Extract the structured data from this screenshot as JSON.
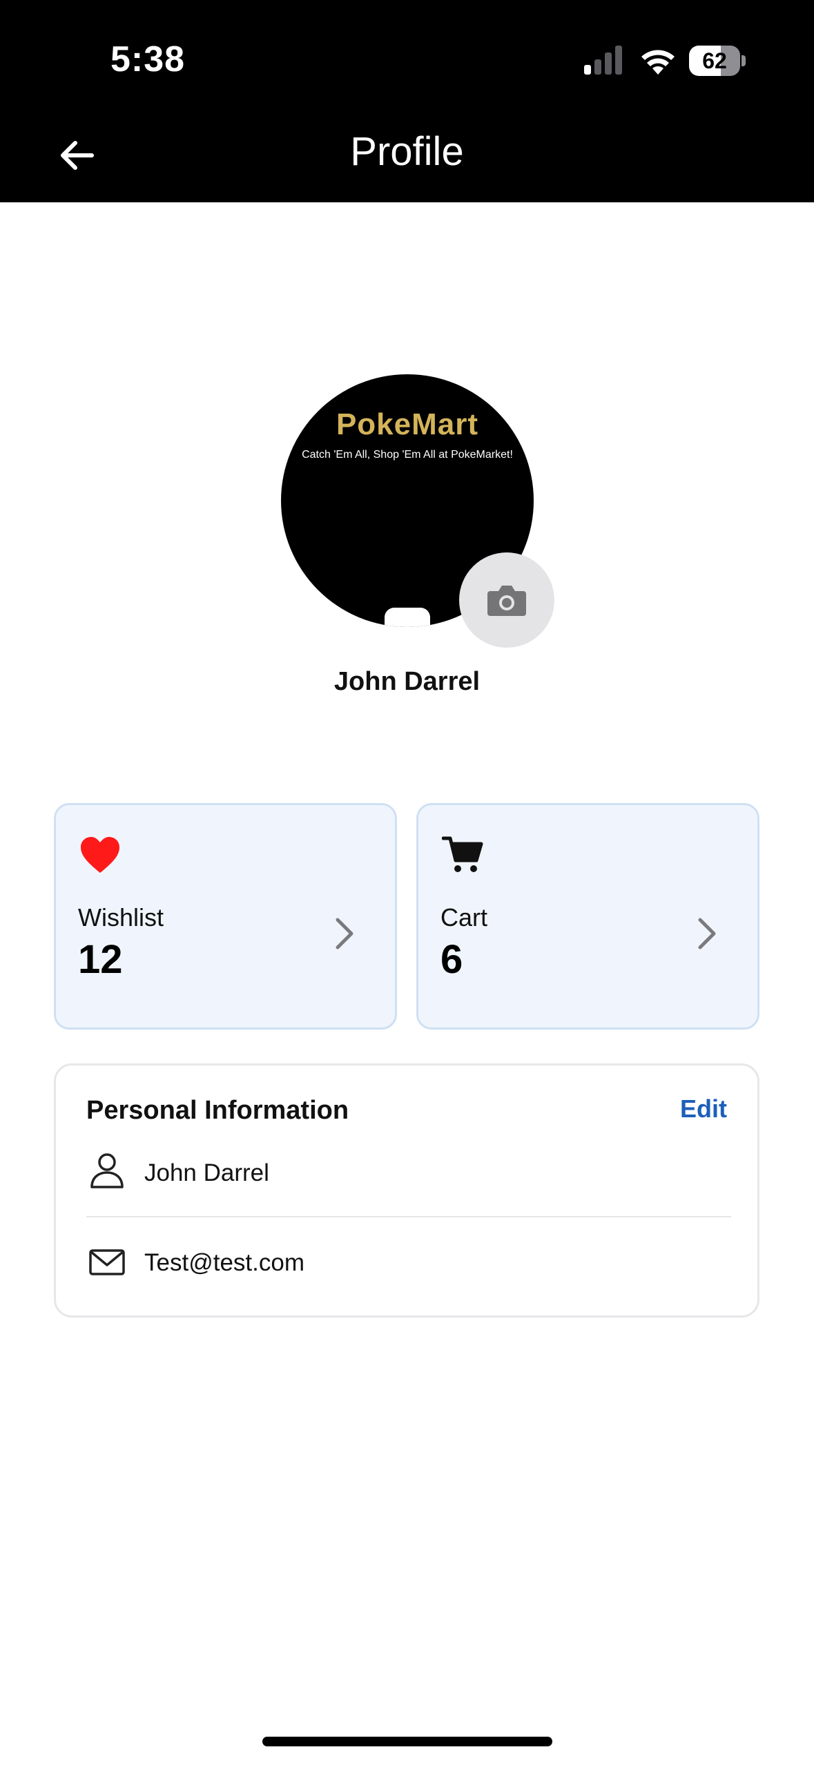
{
  "status_bar": {
    "time": "5:38",
    "battery_level": "62",
    "battery_fraction": 0.62,
    "icons": [
      "signal-icon",
      "wifi-icon",
      "battery-icon"
    ]
  },
  "header": {
    "title": "Profile",
    "back_icon": "arrow-left-icon"
  },
  "avatar": {
    "brand_name": "PokeMart",
    "tagline": "Catch 'Em All, Shop 'Em All at PokeMarket!",
    "camera_icon": "camera-icon"
  },
  "user": {
    "name": "John Darrel"
  },
  "stats": {
    "wishlist": {
      "label": "Wishlist",
      "count": "12",
      "icon": "heart-icon",
      "icon_color": "#ff1a1a"
    },
    "cart": {
      "label": "Cart",
      "count": "6",
      "icon": "cart-icon",
      "icon_color": "#111111"
    }
  },
  "personal_info": {
    "title": "Personal Information",
    "edit_label": "Edit",
    "name": "John Darrel",
    "email": "Test@test.com",
    "name_icon": "person-icon",
    "email_icon": "mail-icon"
  },
  "colors": {
    "header_bg": "#000000",
    "card_bg": "#f0f5fd",
    "card_border": "#cfe0f3",
    "accent": "#1d5fba",
    "brand_gold": "#d4b45a"
  }
}
